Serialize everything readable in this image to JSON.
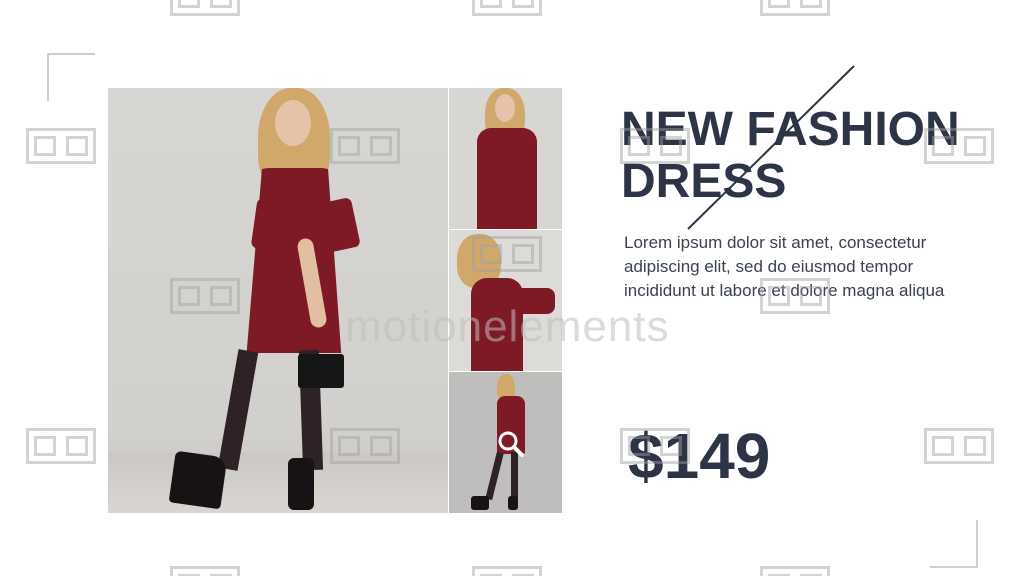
{
  "slide": {
    "title_line1": "NEW FASHION",
    "title_line2": "DRESS",
    "body": "Lorem ipsum dolor sit amet, consectetur adipiscing elit, sed do eiusmod tempor incididunt ut labore et dolore magna aliqua",
    "price": "$149"
  },
  "gallery": {
    "images": [
      {
        "name": "main-photo",
        "desc_icon": "model-full-body"
      },
      {
        "name": "thumb-1",
        "desc_icon": "model-closeup"
      },
      {
        "name": "thumb-2",
        "desc_icon": "model-side"
      },
      {
        "name": "thumb-3",
        "desc_icon": "model-full-body"
      }
    ],
    "zoom_icon": "magnifier-icon"
  },
  "watermark": {
    "text": "motionelements"
  },
  "colors": {
    "title": "#2c3446",
    "body_text": "#3a4150",
    "dress": "#7e1a26",
    "accent_line": "#2c3446"
  }
}
